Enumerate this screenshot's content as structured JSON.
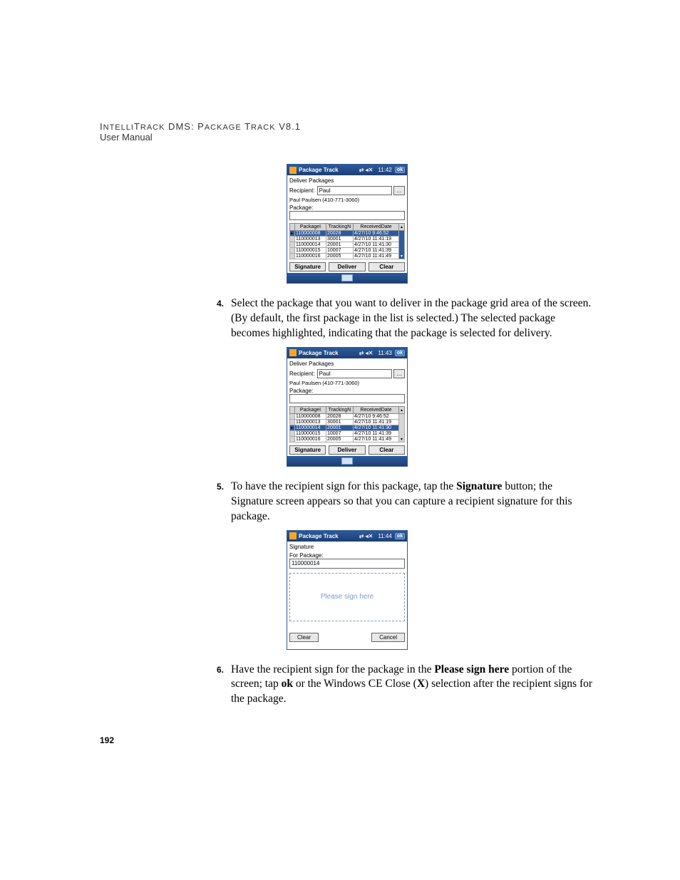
{
  "header": {
    "line1_a": "I",
    "line1_b": "NTELLI",
    "line1_c": "T",
    "line1_d": "RACK",
    "line1_e": " DMS: P",
    "line1_f": "ACKAGE",
    "line1_g": " T",
    "line1_h": "RACK",
    "line1_i": " V8.1",
    "line2": "User Manual"
  },
  "pda1": {
    "title": "Package Track",
    "time": "11:42",
    "ok": "ok",
    "subtitle": "Deliver Packages",
    "recipient_label": "Recipient:",
    "recipient_value": "Paul",
    "recipient_info": "Paul Paulsen (410-771-3060)",
    "package_label": "Package:",
    "cols": [
      "PackageI",
      "TrackingN",
      "ReceivedDate"
    ],
    "rows": [
      {
        "sel": true,
        "c": [
          "110000008",
          "20028",
          "4/27/10 9:46:52"
        ]
      },
      {
        "sel": false,
        "c": [
          "110000013",
          "30001",
          "4/27/10 11:41:19"
        ]
      },
      {
        "sel": false,
        "c": [
          "110000014",
          "20001",
          "4/27/10 11:41:30"
        ]
      },
      {
        "sel": false,
        "c": [
          "110000015",
          "10007",
          "4/27/10 11:41:39"
        ]
      },
      {
        "sel": false,
        "c": [
          "110000016",
          "20005",
          "4/27/10 11:41:49"
        ]
      }
    ],
    "buttons": [
      "Signature",
      "Deliver",
      "Clear"
    ]
  },
  "step4": {
    "num": "4.",
    "text": "Select the package that you want to deliver in the package grid area of the screen. (By default, the first package in the list is selected.) The selected package becomes highlighted, indicating that the package is selected for delivery."
  },
  "pda2": {
    "title": "Package Track",
    "time": "11:43",
    "ok": "ok",
    "subtitle": "Deliver Packages",
    "recipient_label": "Recipient:",
    "recipient_value": "Paul",
    "recipient_info": "Paul Paulsen (410-771-3060)",
    "package_label": "Package:",
    "cols": [
      "PackageI",
      "TrackingN",
      "ReceivedDate"
    ],
    "rows": [
      {
        "sel": false,
        "c": [
          "110000008",
          "20028",
          "4/27/10 9:46:52"
        ]
      },
      {
        "sel": false,
        "c": [
          "110000013",
          "30001",
          "4/27/10 11:41:19"
        ]
      },
      {
        "sel": true,
        "c": [
          "110000014",
          "20001",
          "4/27/10 11:41:30"
        ]
      },
      {
        "sel": false,
        "c": [
          "110000015",
          "10007",
          "4/27/10 11:41:39"
        ]
      },
      {
        "sel": false,
        "c": [
          "110000016",
          "20005",
          "4/27/10 11:41:49"
        ]
      }
    ],
    "buttons": [
      "Signature",
      "Deliver",
      "Clear"
    ]
  },
  "step5": {
    "num": "5.",
    "text_a": "To have the recipient sign for this package, tap the ",
    "bold_a": "Signature",
    "text_b": " button; the Signature screen appears so that you can capture a recipient signature for this package."
  },
  "pda3": {
    "title": "Package Track",
    "time": "11:44",
    "ok": "ok",
    "subtitle": "Signature",
    "for_label": "For Package:",
    "for_value": "110000014",
    "sign_here": "Please sign here",
    "buttons": [
      "Clear",
      "Cancel"
    ]
  },
  "step6": {
    "num": "6.",
    "text_a": "Have the recipient sign for the package in the ",
    "bold_a": "Please sign here",
    "text_b": " portion of the screen; tap ",
    "bold_b": "ok",
    "text_c": " or the Windows CE Close (",
    "bold_c": "X",
    "text_d": ") selection after the recipient signs for the package."
  },
  "page_number": "192"
}
